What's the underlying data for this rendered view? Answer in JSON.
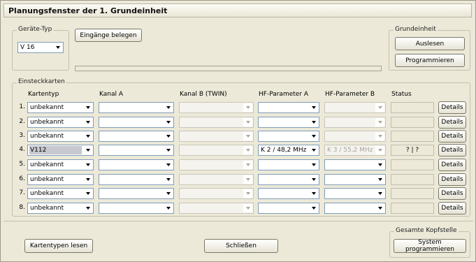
{
  "window": {
    "title": "Planungsfenster der 1. Grundeinheit"
  },
  "geraetetyp": {
    "legend": "Geräte-Typ",
    "selected": "V 16"
  },
  "eingaenge_button": "Eingänge belegen",
  "grundeinheit": {
    "legend": "Grundeinheit",
    "auslesen": "Auslesen",
    "programmieren": "Programmieren"
  },
  "einsteckkarten": {
    "legend": "Einsteckkarten",
    "headers": {
      "kartentyp": "Kartentyp",
      "kanal_a": "Kanal A",
      "kanal_b": "Kanal B (TWIN)",
      "hf_a": "HF-Parameter A",
      "hf_b": "HF-Parameter B",
      "status": "Status"
    },
    "details_label": "Details",
    "rows": [
      {
        "num": "1.",
        "kartentyp": "unbekannt",
        "kanal_a": "",
        "kanal_b": "",
        "hf_a": "",
        "hf_b": "",
        "status": ""
      },
      {
        "num": "2.",
        "kartentyp": "unbekannt",
        "kanal_a": "",
        "kanal_b": "",
        "hf_a": "",
        "hf_b": "",
        "status": ""
      },
      {
        "num": "3.",
        "kartentyp": "unbekannt",
        "kanal_a": "",
        "kanal_b": "",
        "hf_a": "",
        "hf_b": "",
        "status": ""
      },
      {
        "num": "4.",
        "kartentyp": "V112",
        "kanal_a": "",
        "kanal_b": "",
        "hf_a": "K 2 / 48,2 MHz",
        "hf_b": "K 3 / 55,2 MHz",
        "status": "?  |  ?"
      },
      {
        "num": "5.",
        "kartentyp": "unbekannt",
        "kanal_a": "",
        "kanal_b": "",
        "hf_a": "",
        "hf_b": "",
        "status": ""
      },
      {
        "num": "6.",
        "kartentyp": "unbekannt",
        "kanal_a": "",
        "kanal_b": "",
        "hf_a": "",
        "hf_b": "",
        "status": ""
      },
      {
        "num": "7.",
        "kartentyp": "unbekannt",
        "kanal_a": "",
        "kanal_b": "",
        "hf_a": "",
        "hf_b": "",
        "status": ""
      },
      {
        "num": "8.",
        "kartentyp": "unbekannt",
        "kanal_a": "",
        "kanal_b": "",
        "hf_a": "",
        "hf_b": "",
        "status": ""
      }
    ]
  },
  "footer": {
    "kartentypen_lesen": "Kartentypen lesen",
    "schliessen": "Schließen",
    "gesamte_legend": "Gesamte Kopfstelle",
    "system_programmieren": "System programmieren"
  }
}
